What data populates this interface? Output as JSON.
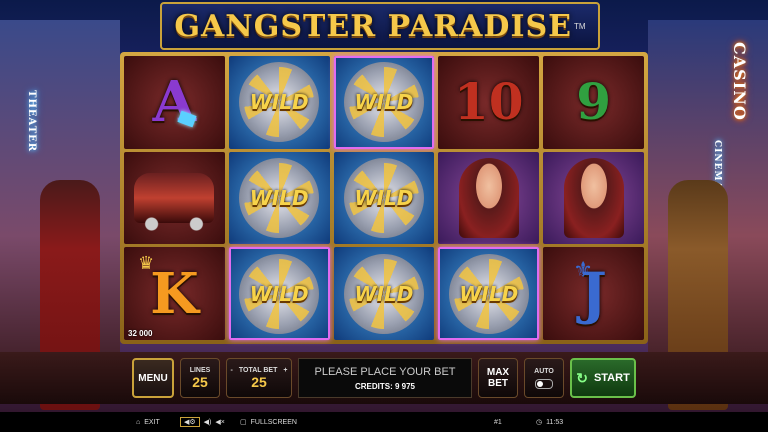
{
  "title": {
    "text": "GANGSTER PARADISE",
    "tm": "TM"
  },
  "signs": {
    "theater": "THEATER",
    "casino": "CASINO",
    "cinema": "CINEMA"
  },
  "reels": [
    [
      {
        "symbol": "A",
        "kind": "letter",
        "color": "#8a3ad0"
      },
      {
        "symbol": "car",
        "kind": "car"
      },
      {
        "symbol": "K",
        "kind": "letter",
        "color": "#f59a20",
        "win": "32 000"
      }
    ],
    [
      {
        "symbol": "WILD",
        "kind": "wild"
      },
      {
        "symbol": "WILD",
        "kind": "wild"
      },
      {
        "symbol": "WILD",
        "kind": "wild",
        "frame": true
      }
    ],
    [
      {
        "symbol": "WILD",
        "kind": "wild",
        "frame": true
      },
      {
        "symbol": "WILD",
        "kind": "wild"
      },
      {
        "symbol": "WILD",
        "kind": "wild"
      }
    ],
    [
      {
        "symbol": "10",
        "kind": "num",
        "color": "#c03020"
      },
      {
        "symbol": "lady",
        "kind": "lady"
      },
      {
        "symbol": "WILD",
        "kind": "wild",
        "frame": true
      }
    ],
    [
      {
        "symbol": "9",
        "kind": "num",
        "color": "#30a040"
      },
      {
        "symbol": "lady",
        "kind": "lady"
      },
      {
        "symbol": "J",
        "kind": "letter",
        "color": "#3a6ad0"
      }
    ]
  ],
  "controls": {
    "menu": "MENU",
    "lines_label": "LINES",
    "lines_value": "25",
    "total_bet_label": "TOTAL BET",
    "total_bet_value": "25",
    "minus": "-",
    "plus": "+",
    "message": "PLEASE PLACE YOUR BET",
    "credits": "CREDITS: 9 975",
    "max": "MAX",
    "bet": "BET",
    "auto": "AUTO",
    "start": "START"
  },
  "statusbar": {
    "exit": "EXIT",
    "fullscreen": "FULLSCREEN",
    "round": "#1",
    "time": "11:53"
  },
  "colors": {
    "gold": "#c9a23a",
    "wild_text": "#f7d34a",
    "start_green": "#6ac04a"
  }
}
